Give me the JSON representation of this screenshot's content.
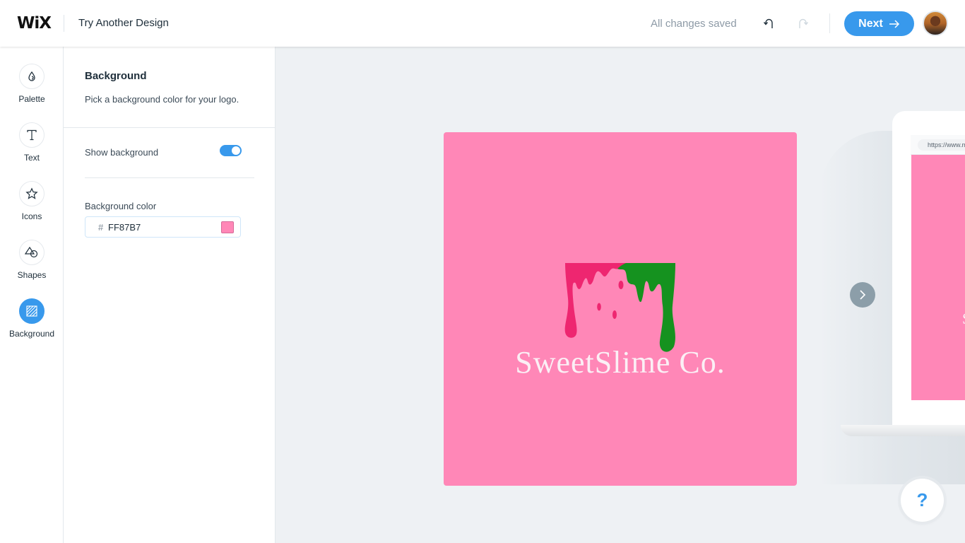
{
  "header": {
    "brand": "WiX",
    "title": "Try Another Design",
    "save_status": "All changes saved",
    "undo_icon": "undo-icon",
    "redo_icon": "redo-icon",
    "next_label": "Next",
    "next_icon": "arrow-right-icon",
    "avatar": "user-avatar"
  },
  "sidebar": {
    "items": [
      {
        "label": "Palette",
        "icon": "drop-icon",
        "active": false
      },
      {
        "label": "Text",
        "icon": "text-icon",
        "active": false
      },
      {
        "label": "Icons",
        "icon": "star-icon",
        "active": false
      },
      {
        "label": "Shapes",
        "icon": "shapes-icon",
        "active": false
      },
      {
        "label": "Background",
        "icon": "background-icon",
        "active": true
      }
    ]
  },
  "panel": {
    "title": "Background",
    "description": "Pick a background color for your logo.",
    "show_background": {
      "label": "Show background",
      "enabled": true
    },
    "background_color": {
      "label": "Background color",
      "hash": "#",
      "value": "FF87B7",
      "swatch": "#FF87B7"
    }
  },
  "canvas": {
    "logo_text": "SweetSlime Co.",
    "background": "#FF87B7",
    "drip_colors": {
      "left": "#EE2670",
      "right": "#15921F"
    },
    "nav_next_icon": "chevron-right-icon"
  },
  "mockup": {
    "url": "https://www.m",
    "letter": "S"
  },
  "help": {
    "label": "?"
  },
  "colors": {
    "accent": "#3899EC",
    "text": "#20303C",
    "muted": "#8D9AA6"
  }
}
